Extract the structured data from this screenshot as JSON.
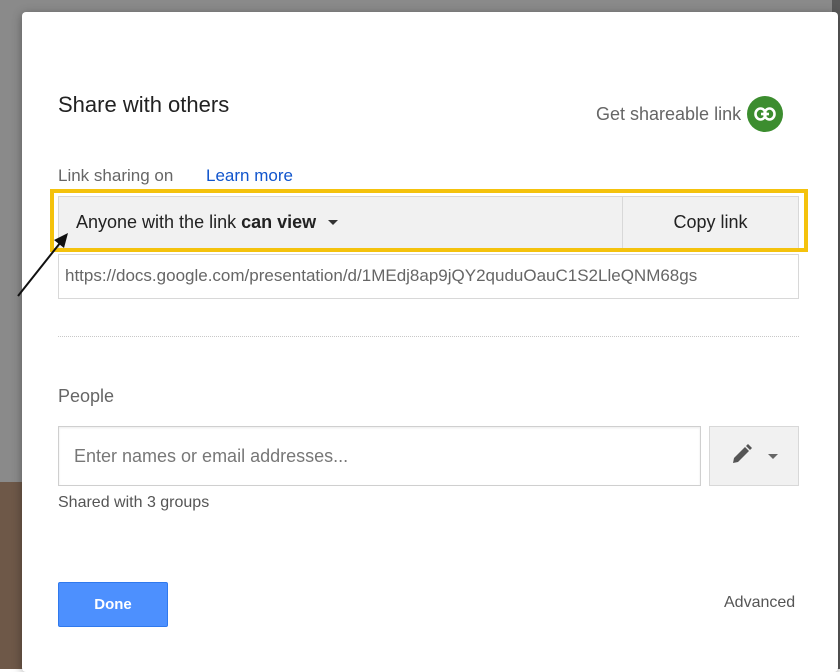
{
  "dialog": {
    "title": "Share with others",
    "get_link_label": "Get shareable link",
    "link_status": "Link sharing on",
    "learn_more": "Learn more",
    "permission_prefix": "Anyone with the link",
    "permission_value": "can view",
    "copy_link": "Copy link",
    "url": "https://docs.google.com/presentation/d/1MEdj8ap9jQY2quduOauC1S2LleQNM68gs",
    "people_label": "People",
    "people_placeholder": "Enter names or email addresses...",
    "shared_with": "Shared with 3 groups",
    "done": "Done",
    "advanced": "Advanced"
  },
  "colors": {
    "highlight": "#f4c20d",
    "link_icon_bg": "#3c8d2f",
    "done_bg": "#4d90fe",
    "learn_more": "#1155cc"
  },
  "icons": [
    "link-icon",
    "caret-down-icon",
    "pencil-icon",
    "arrow-annotation"
  ]
}
